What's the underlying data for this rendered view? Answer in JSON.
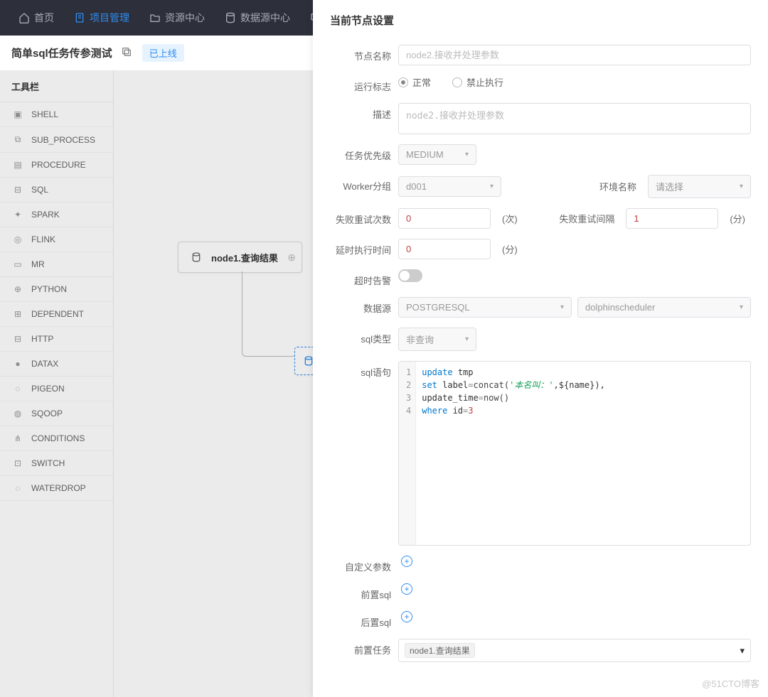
{
  "topnav": {
    "home": "首页",
    "project": "项目管理",
    "resource": "资源中心",
    "datasource": "数据源中心"
  },
  "page": {
    "title": "简单sql任务传参测试",
    "status": "已上线"
  },
  "sidebar": {
    "title": "工具栏",
    "items": [
      "SHELL",
      "SUB_PROCESS",
      "PROCEDURE",
      "SQL",
      "SPARK",
      "FLINK",
      "MR",
      "PYTHON",
      "DEPENDENT",
      "HTTP",
      "DATAX",
      "PIGEON",
      "SQOOP",
      "CONDITIONS",
      "SWITCH",
      "WATERDROP"
    ]
  },
  "canvas": {
    "node1": "node1.查询结果"
  },
  "panel": {
    "title": "当前节点设置",
    "labels": {
      "nodeName": "节点名称",
      "runFlag": "运行标志",
      "normal": "正常",
      "forbid": "禁止执行",
      "desc": "描述",
      "priority": "任务优先级",
      "workerGroup": "Worker分组",
      "envName": "环境名称",
      "retryTimes": "失败重试次数",
      "timesUnit": "(次)",
      "retryInterval": "失败重试间隔",
      "minUnit": "(分)",
      "delay": "延时执行时间",
      "timeoutAlarm": "超时告警",
      "datasource": "数据源",
      "sqlType": "sql类型",
      "sqlStmt": "sql语句",
      "customParams": "自定义参数",
      "preSql": "前置sql",
      "postSql": "后置sql",
      "preTask": "前置任务"
    },
    "values": {
      "nodeName": "node2.接收并处理参数",
      "desc": "node2.接收并处理参数",
      "priority": "MEDIUM",
      "workerGroup": "d001",
      "envPlaceholder": "请选择",
      "retryTimes": "0",
      "retryInterval": "1",
      "delay": "0",
      "dsType": "POSTGRESQL",
      "dsName": "dolphinscheduler",
      "sqlType": "非查询",
      "preTaskTag": "node1.查询结果"
    },
    "code": {
      "l1a": "update",
      "l1b": " tmp",
      "l2a": "set",
      "l2b": " label",
      "l2c": "=",
      "l2d": "concat(",
      "l2e": "'本名叫：'",
      "l2f": ",${name}),",
      "l3a": "update_time",
      "l3b": "=",
      "l3c": "now()",
      "l4a": "where",
      "l4b": " id",
      "l4c": "=",
      "l4d": "3"
    }
  },
  "watermark": "@51CTO博客"
}
